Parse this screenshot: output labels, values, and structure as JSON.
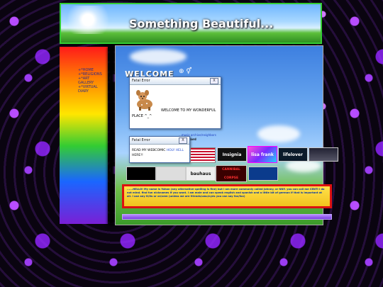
{
  "header": {
    "title": "Something Beautiful..."
  },
  "sidebar": {
    "items": [
      {
        "label": "+*HOME"
      },
      {
        "label": "+*RELIGIONS"
      },
      {
        "label": "+*ART"
      },
      {
        "label": "GALLERY"
      },
      {
        "label": "+*VIRTUAL"
      },
      {
        "label": "DIARY"
      }
    ]
  },
  "main": {
    "welcome": "WELCOME",
    "links": {
      "line1": "...music archive/neighbors",
      "line2": "my discord"
    }
  },
  "dialogs": {
    "d1": {
      "title": "Fatal Error",
      "close": "X",
      "message1": "WELCOME TO MY WONDERFUL",
      "message2": "PLACE ^_^"
    },
    "d2": {
      "title": "Fatal Error",
      "close": "X",
      "message_a": "READ MY WEBCOMIC",
      "message_b": "HOLY HELL",
      "message_c": "HERE!!"
    }
  },
  "badges": [
    {
      "label": ""
    },
    {
      "label": "Insignia"
    },
    {
      "label": "lisa frank"
    },
    {
      "label": "lifelover"
    },
    {
      "label": ""
    },
    {
      "label": ""
    },
    {
      "label": ""
    },
    {
      "label": "bauhaus"
    },
    {
      "label": "CANNIBAL CORPSE"
    },
    {
      "label": ""
    }
  ],
  "bio": {
    "text": "......HELLO! My name is Yohan (any alternative spelling is fine) but i am more commonly called Johnny, or NNY. you can call me CENTI i do not mind. find fun nicknames if you want. i am male and can speak english and spanish and a little bit of german if that is important at all. i use any it/its or xe/xem (unless we are friends/uwu/nyes you can say fox/fox)"
  },
  "colors": {
    "accent_green": "#33cc33",
    "bio_border": "#dd1111",
    "bio_text": "#0033aa"
  }
}
